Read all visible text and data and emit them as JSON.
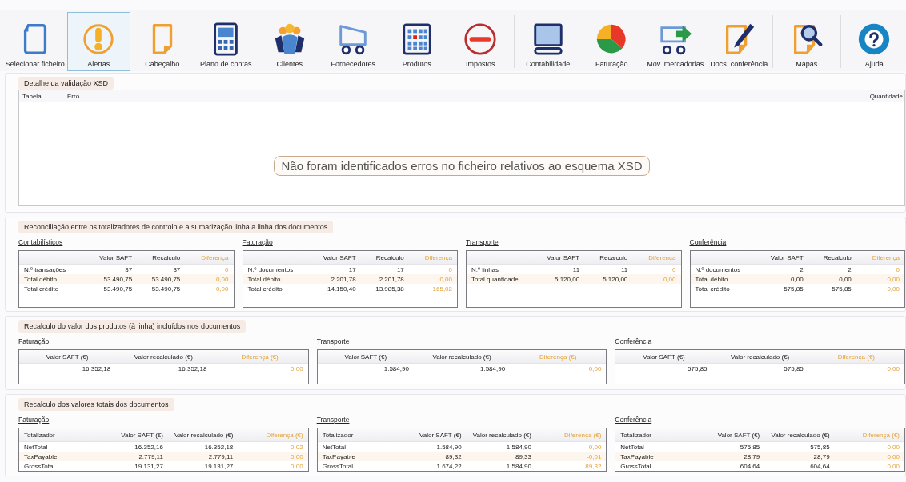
{
  "toolbar": [
    {
      "label": "Selecionar ficheiro",
      "selected": false
    },
    {
      "label": "Alertas",
      "selected": true
    },
    {
      "label": "Cabeçalho",
      "selected": false
    },
    {
      "label": "Plano de contas",
      "selected": false
    },
    {
      "label": "Clientes",
      "selected": false
    },
    {
      "label": "Fornecedores",
      "selected": false
    },
    {
      "label": "Produtos",
      "selected": false
    },
    {
      "label": "Impostos",
      "selected": false
    },
    {
      "label": "Contabilidade",
      "selected": false
    },
    {
      "label": "Faturação",
      "selected": false
    },
    {
      "label": "Mov. mercadorias",
      "selected": false
    },
    {
      "label": "Docs. conferência",
      "selected": false
    },
    {
      "label": "Mapas",
      "selected": false
    },
    {
      "label": "Ajuda",
      "selected": false
    }
  ],
  "xsd_panel": {
    "title": "Detalhe da validação XSD",
    "columns": [
      "Tabela",
      "Erro",
      "Quantidade"
    ],
    "message": "Não foram identificados erros no ficheiro relativos ao esquema XSD"
  },
  "sections": [
    {
      "title": "Reconciliação entre os totalizadores de controlo e a sumarização linha a linha dos documentos",
      "groups": [
        {
          "title": "Contabilísticos",
          "columns": [
            {
              "kind": "label"
            },
            {
              "label": "Valor SAFT",
              "kind": "value"
            },
            {
              "label": "Recalculo",
              "kind": "value"
            },
            {
              "label": "Diferença",
              "kind": "difference"
            }
          ],
          "rows": [
            [
              "N.º transações",
              "37",
              "37",
              "0"
            ],
            [
              "Total débito",
              "53.490,75",
              "53.490,75",
              "0,00"
            ],
            [
              "Total crédito",
              "53.490,75",
              "53.490,75",
              "0,00"
            ]
          ]
        },
        {
          "title": "Faturação",
          "columns": [
            {
              "kind": "label"
            },
            {
              "label": "Valor SAFT",
              "kind": "value"
            },
            {
              "label": "Recalculo",
              "kind": "value"
            },
            {
              "label": "Diferença",
              "kind": "difference"
            }
          ],
          "rows": [
            [
              "N.º documentos",
              "17",
              "17",
              "0"
            ],
            [
              "Total débito",
              "2.201,78",
              "2.201,78",
              "0,00"
            ],
            [
              "Total crédito",
              "14.150,40",
              "13.985,38",
              "165,02"
            ]
          ]
        },
        {
          "title": "Transporte",
          "columns": [
            {
              "kind": "label"
            },
            {
              "label": "Valor SAFT",
              "kind": "value"
            },
            {
              "label": "Recalculo",
              "kind": "value"
            },
            {
              "label": "Diferença",
              "kind": "difference"
            }
          ],
          "rows": [
            [
              "N.º linhas",
              "11",
              "11",
              "0"
            ],
            [
              "Total quantidade",
              "5.120,00",
              "5.120,00",
              "0,00"
            ]
          ]
        },
        {
          "title": "Conferência",
          "columns": [
            {
              "kind": "label"
            },
            {
              "label": "Valor SAFT",
              "kind": "value"
            },
            {
              "label": "Recalculo",
              "kind": "value"
            },
            {
              "label": "Diferença",
              "kind": "difference"
            }
          ],
          "rows": [
            [
              "N.º documentos",
              "2",
              "2",
              "0"
            ],
            [
              "Total débito",
              "0,00",
              "0,00",
              "0,00"
            ],
            [
              "Total crédito",
              "575,85",
              "575,85",
              "0,00"
            ]
          ]
        }
      ]
    },
    {
      "title": "Recalculo do valor dos produtos (à linha) incluídos nos documentos",
      "groups": [
        {
          "title": "Faturação",
          "columns": [
            {
              "label": "Valor SAFT (€)",
              "kind": "value"
            },
            {
              "label": "Valor recalculado (€)",
              "kind": "value"
            },
            {
              "label": "Diferença (€)",
              "kind": "difference"
            }
          ],
          "rows": [
            [
              "16.352,18",
              "16.352,18",
              "0,00"
            ]
          ]
        },
        {
          "title": "Transporte",
          "columns": [
            {
              "label": "Valor SAFT (€)",
              "kind": "value"
            },
            {
              "label": "Valor recalculado (€)",
              "kind": "value"
            },
            {
              "label": "Diferença (€)",
              "kind": "difference"
            }
          ],
          "rows": [
            [
              "1.584,90",
              "1.584,90",
              "0,00"
            ]
          ]
        },
        {
          "title": "Conferência",
          "columns": [
            {
              "label": "Valor SAFT (€)",
              "kind": "value"
            },
            {
              "label": "Valor recalculado (€)",
              "kind": "value"
            },
            {
              "label": "Diferença (€)",
              "kind": "difference"
            }
          ],
          "rows": [
            [
              "575,85",
              "575,85",
              "0,00"
            ]
          ]
        }
      ]
    },
    {
      "title": "Recalculo dos valores totais dos documentos",
      "groups": [
        {
          "title": "Faturação",
          "columns": [
            {
              "label": "Totalizador",
              "kind": "label"
            },
            {
              "label": "Valor SAFT (€)",
              "kind": "value"
            },
            {
              "label": "Valor recalculado (€)",
              "kind": "value"
            },
            {
              "label": "Diferença (€)",
              "kind": "difference"
            }
          ],
          "rows": [
            [
              "NetTotal",
              "16.352,16",
              "16.352,18",
              "-0,02"
            ],
            [
              "TaxPayable",
              "2.779,11",
              "2.779,11",
              "0,00"
            ],
            [
              "GrossTotal",
              "19.131,27",
              "19.131,27",
              "0,00"
            ]
          ]
        },
        {
          "title": "Transporte",
          "columns": [
            {
              "label": "Totalizador",
              "kind": "label"
            },
            {
              "label": "Valor SAFT (€)",
              "kind": "value"
            },
            {
              "label": "Valor recalculado (€)",
              "kind": "value"
            },
            {
              "label": "Diferença (€)",
              "kind": "difference"
            }
          ],
          "rows": [
            [
              "NetTotal",
              "1.584,90",
              "1.584,90",
              "0,00"
            ],
            [
              "TaxPayable",
              "89,32",
              "89,33",
              "-0,01"
            ],
            [
              "GrossTotal",
              "1.674,22",
              "1.584,90",
              "89,32"
            ]
          ]
        },
        {
          "title": "Conferência",
          "columns": [
            {
              "label": "Totalizador",
              "kind": "label"
            },
            {
              "label": "Valor SAFT (€)",
              "kind": "value"
            },
            {
              "label": "Valor recalculado (€)",
              "kind": "value"
            },
            {
              "label": "Diferença (€)",
              "kind": "difference"
            }
          ],
          "rows": [
            [
              "NetTotal",
              "575,85",
              "575,85",
              "0,00"
            ],
            [
              "TaxPayable",
              "28,79",
              "28,79",
              "0,00"
            ],
            [
              "GrossTotal",
              "604,64",
              "604,64",
              "0,00"
            ]
          ]
        }
      ]
    }
  ]
}
